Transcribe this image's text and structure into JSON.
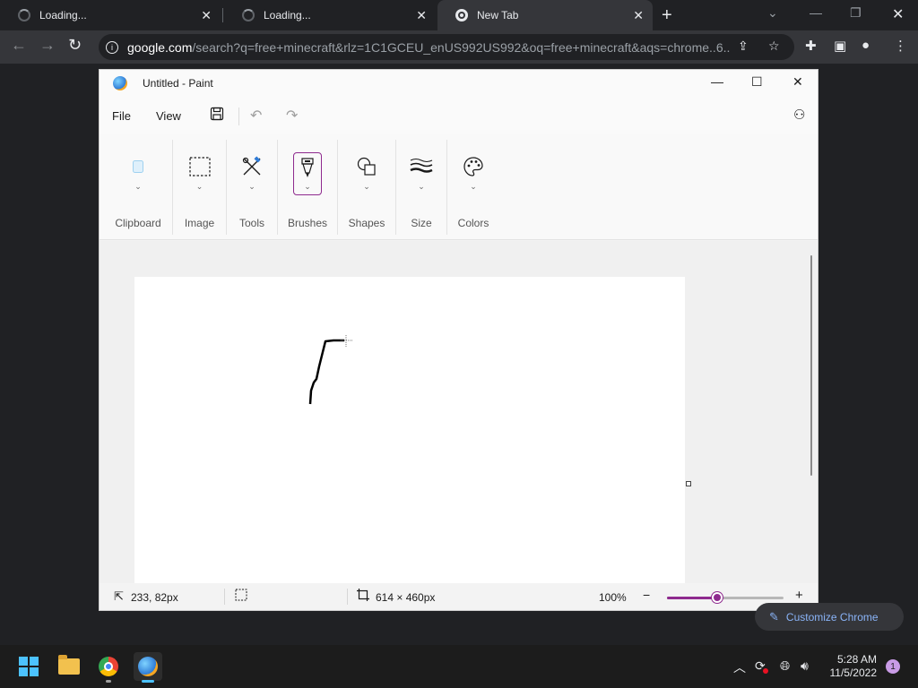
{
  "browser": {
    "tabs": [
      {
        "title": "Loading...",
        "loading": true,
        "active": false
      },
      {
        "title": "Loading...",
        "loading": true,
        "active": false
      },
      {
        "title": "New Tab",
        "loading": false,
        "active": true
      }
    ],
    "url_host": "google.com",
    "url_rest": "/search?q=free+minecraft&rlz=1C1GCEU_enUS992US992&oq=free+minecraft&aqs=chrome..6...",
    "customize_label": "Customize Chrome"
  },
  "paint": {
    "title": "Untitled - Paint",
    "menu": {
      "file": "File",
      "view": "View"
    },
    "ribbon_groups": [
      {
        "label": "Clipboard",
        "icon": "clipboard-icon"
      },
      {
        "label": "Image",
        "icon": "selection-icon"
      },
      {
        "label": "Tools",
        "icon": "tools-icon"
      },
      {
        "label": "Brushes",
        "icon": "brush-icon",
        "selected": true
      },
      {
        "label": "Shapes",
        "icon": "shapes-icon"
      },
      {
        "label": "Size",
        "icon": "size-icon"
      },
      {
        "label": "Colors",
        "icon": "palette-icon"
      }
    ],
    "status": {
      "cursor_pos": "233, 82px",
      "canvas_size": "614 × 460px",
      "zoom": "100%",
      "zoom_level": 0.43
    },
    "accent": "#8e2a8e"
  },
  "taskbar": {
    "time": "5:28 AM",
    "date": "11/5/2022",
    "notification_count": "1",
    "apps": [
      "start-icon",
      "file-explorer-icon",
      "chrome-icon",
      "paint-icon"
    ]
  }
}
